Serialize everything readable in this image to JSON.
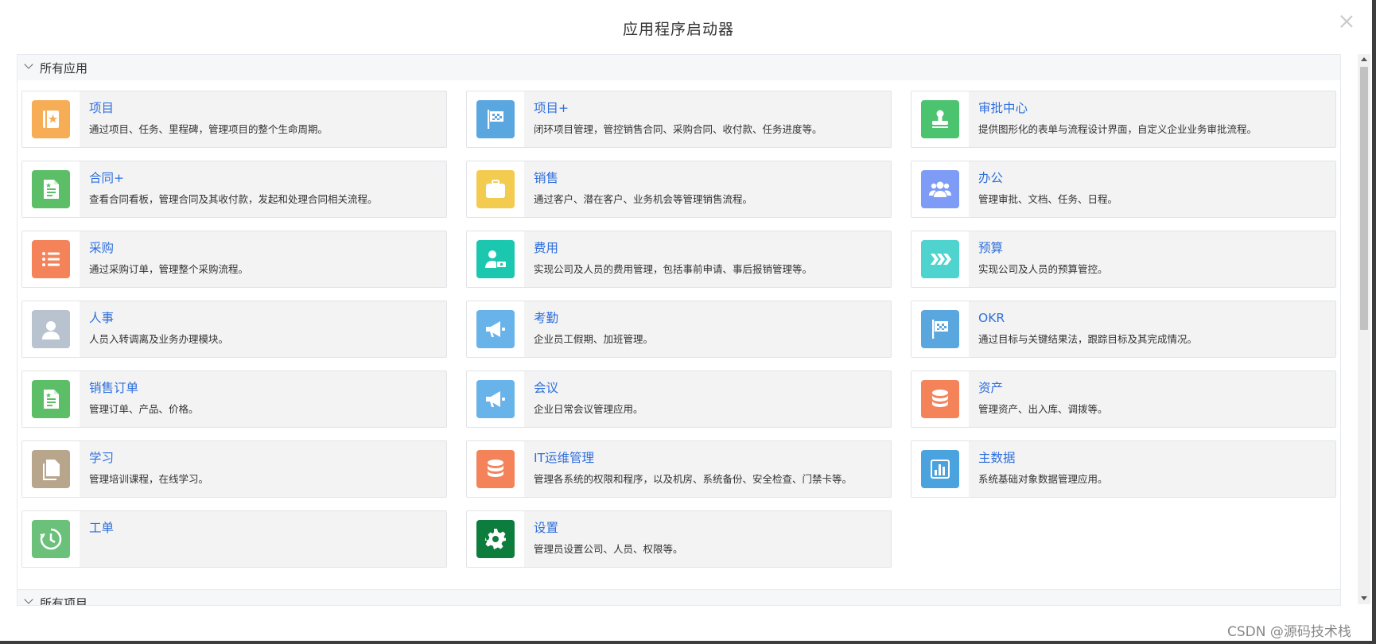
{
  "modal": {
    "title": "应用程序启动器"
  },
  "sections": [
    {
      "title": "所有应用"
    },
    {
      "title": "所有项目"
    }
  ],
  "apps": [
    {
      "name": "项目",
      "desc": "通过项目、任务、里程碑，管理项目的整个生命周期。",
      "icon": "project-book-icon",
      "color": "#f6ad55"
    },
    {
      "name": "项目+",
      "desc": "闭环项目管理，管控销售合同、采购合同、收付款、任务进度等。",
      "icon": "flag-icon",
      "color": "#5aa7e0"
    },
    {
      "name": "审批中心",
      "desc": "提供图形化的表单与流程设计界面，自定义企业业务审批流程。",
      "icon": "stamp-icon",
      "color": "#4cc36f"
    },
    {
      "name": "合同+",
      "desc": "查看合同看板，管理合同及其收付款，发起和处理合同相关流程。",
      "icon": "document-icon",
      "color": "#5cbf68"
    },
    {
      "name": "销售",
      "desc": "通过客户、潜在客户、业务机会等管理销售流程。",
      "icon": "briefcase-icon",
      "color": "#f3cb4f"
    },
    {
      "name": "办公",
      "desc": "管理审批、文档、任务、日程。",
      "icon": "users-icon",
      "color": "#7e9cf5"
    },
    {
      "name": "采购",
      "desc": "通过采购订单，管理整个采购流程。",
      "icon": "list-icon",
      "color": "#f5835a"
    },
    {
      "name": "费用",
      "desc": "实现公司及人员的费用管理，包括事前申请、事后报销管理等。",
      "icon": "user-money-icon",
      "color": "#1cc7b0"
    },
    {
      "name": "预算",
      "desc": "实现公司及人员的预算管控。",
      "icon": "chevrons-icon",
      "color": "#4fd3cf"
    },
    {
      "name": "人事",
      "desc": "人员入转调离及业务办理模块。",
      "icon": "person-icon",
      "color": "#b9c2cf"
    },
    {
      "name": "考勤",
      "desc": "企业员工假期、加班管理。",
      "icon": "megaphone-icon",
      "color": "#67b3ea"
    },
    {
      "name": "OKR",
      "desc": "通过目标与关键结果法，跟踪目标及其完成情况。",
      "icon": "flag-icon",
      "color": "#5aa7e0"
    },
    {
      "name": "销售订单",
      "desc": "管理订单、产品、价格。",
      "icon": "document-icon",
      "color": "#5cbf68"
    },
    {
      "name": "会议",
      "desc": "企业日常会议管理应用。",
      "icon": "megaphone-icon",
      "color": "#67b3ea"
    },
    {
      "name": "资产",
      "desc": "管理资产、出入库、调拨等。",
      "icon": "database-icon",
      "color": "#f5835a"
    },
    {
      "name": "学习",
      "desc": "管理培训课程，在线学习。",
      "icon": "copy-icon",
      "color": "#b7a58c"
    },
    {
      "name": "IT运维管理",
      "desc": "管理各系统的权限和程序，以及机房、系统备份、安全检查、门禁卡等。",
      "icon": "database-icon",
      "color": "#f5835a"
    },
    {
      "name": "主数据",
      "desc": "系统基础对象数据管理应用。",
      "icon": "bar-chart-icon",
      "color": "#4aa3df"
    },
    {
      "name": "工单",
      "desc": "",
      "icon": "clock-refresh-icon",
      "color": "#6cc17a"
    },
    {
      "name": "设置",
      "desc": "管理员设置公司、人员、权限等。",
      "icon": "gear-icon",
      "color": "#0d7d3d"
    }
  ],
  "watermark": "CSDN @源码技术栈"
}
